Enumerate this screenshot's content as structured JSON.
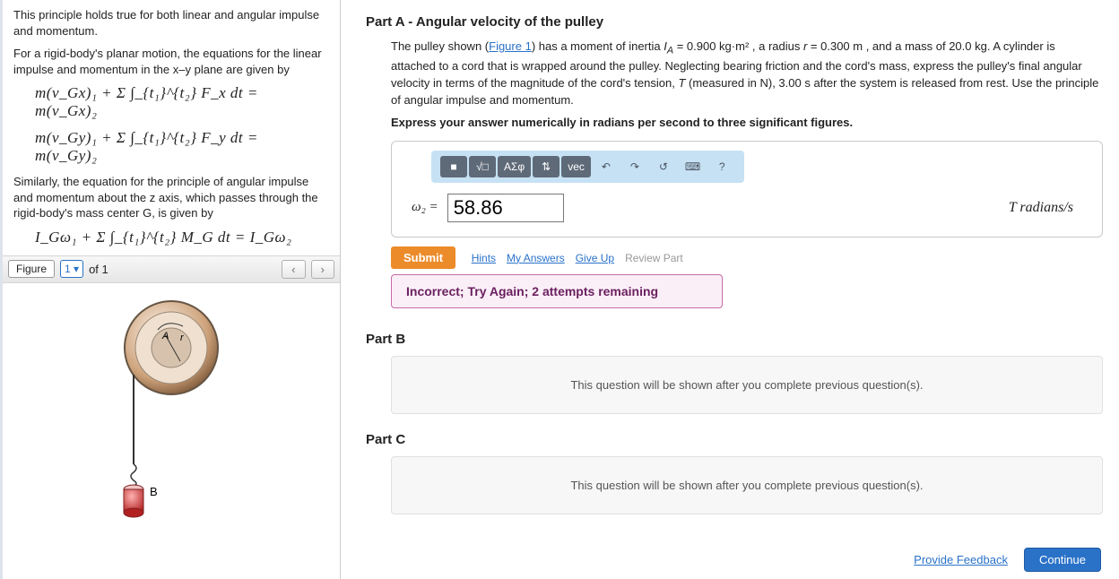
{
  "left": {
    "p1": "This principle holds true for both linear and angular impulse and momentum.",
    "p2": "For a rigid-body's planar motion, the equations for the linear impulse and momentum in the x–y plane are given by",
    "eq1": "m(v_Gx)₁ + Σ ∫_{t₁}^{t₂} F_x dt = m(v_Gx)₂",
    "eq2": "m(v_Gy)₁ + Σ ∫_{t₁}^{t₂} F_y dt = m(v_Gy)₂",
    "p3": "Similarly, the equation for the principle of angular impulse and momentum about the z axis, which passes through the rigid-body's mass center G, is given by",
    "eq3": "I_Gω₁ + Σ ∫_{t₁}^{t₂} M_G dt = I_Gω₂",
    "figure_label": "Figure",
    "figure_num": "1",
    "figure_of": "of 1"
  },
  "partA": {
    "hdr_bold": "Part A",
    "hdr_rest": " - Angular velocity of the pulley",
    "text": "The pulley shown (Figure 1) has a moment of inertia I_A = 0.900 kg·m² , a radius r = 0.300 m , and a mass of 20.0 kg. A cylinder is attached to a cord that is wrapped around the pulley. Neglecting bearing friction and the cord's mass, express the pulley's final angular velocity in terms of the magnitude of the cord's tension, T (measured in N), 3.00 s after the system is released from rest. Use the principle of angular impulse and momentum.",
    "figlink": "Figure 1",
    "instr": "Express your answer numerically in radians per second to three significant figures.",
    "toolbar": {
      "b1": "■",
      "b2": "√□",
      "b3": "ΑΣφ",
      "b4": "⇅",
      "b5": "vec",
      "b6": "↶",
      "b7": "↷",
      "b8": "↺",
      "b9": "⌨",
      "b10": "?"
    },
    "omega": "ω₂ =",
    "value": "58.86",
    "unit": "T radians/s",
    "submit": "Submit",
    "hints": "Hints",
    "myans": "My Answers",
    "giveup": "Give Up",
    "review": "Review Part",
    "incorrect": "Incorrect; Try Again; 2 attempts remaining"
  },
  "partB": {
    "hdr": "Part B",
    "text": "This question will be shown after you complete previous question(s)."
  },
  "partC": {
    "hdr": "Part C",
    "text": "This question will be shown after you complete previous question(s)."
  },
  "footer": {
    "feedback": "Provide Feedback",
    "continue": "Continue"
  }
}
